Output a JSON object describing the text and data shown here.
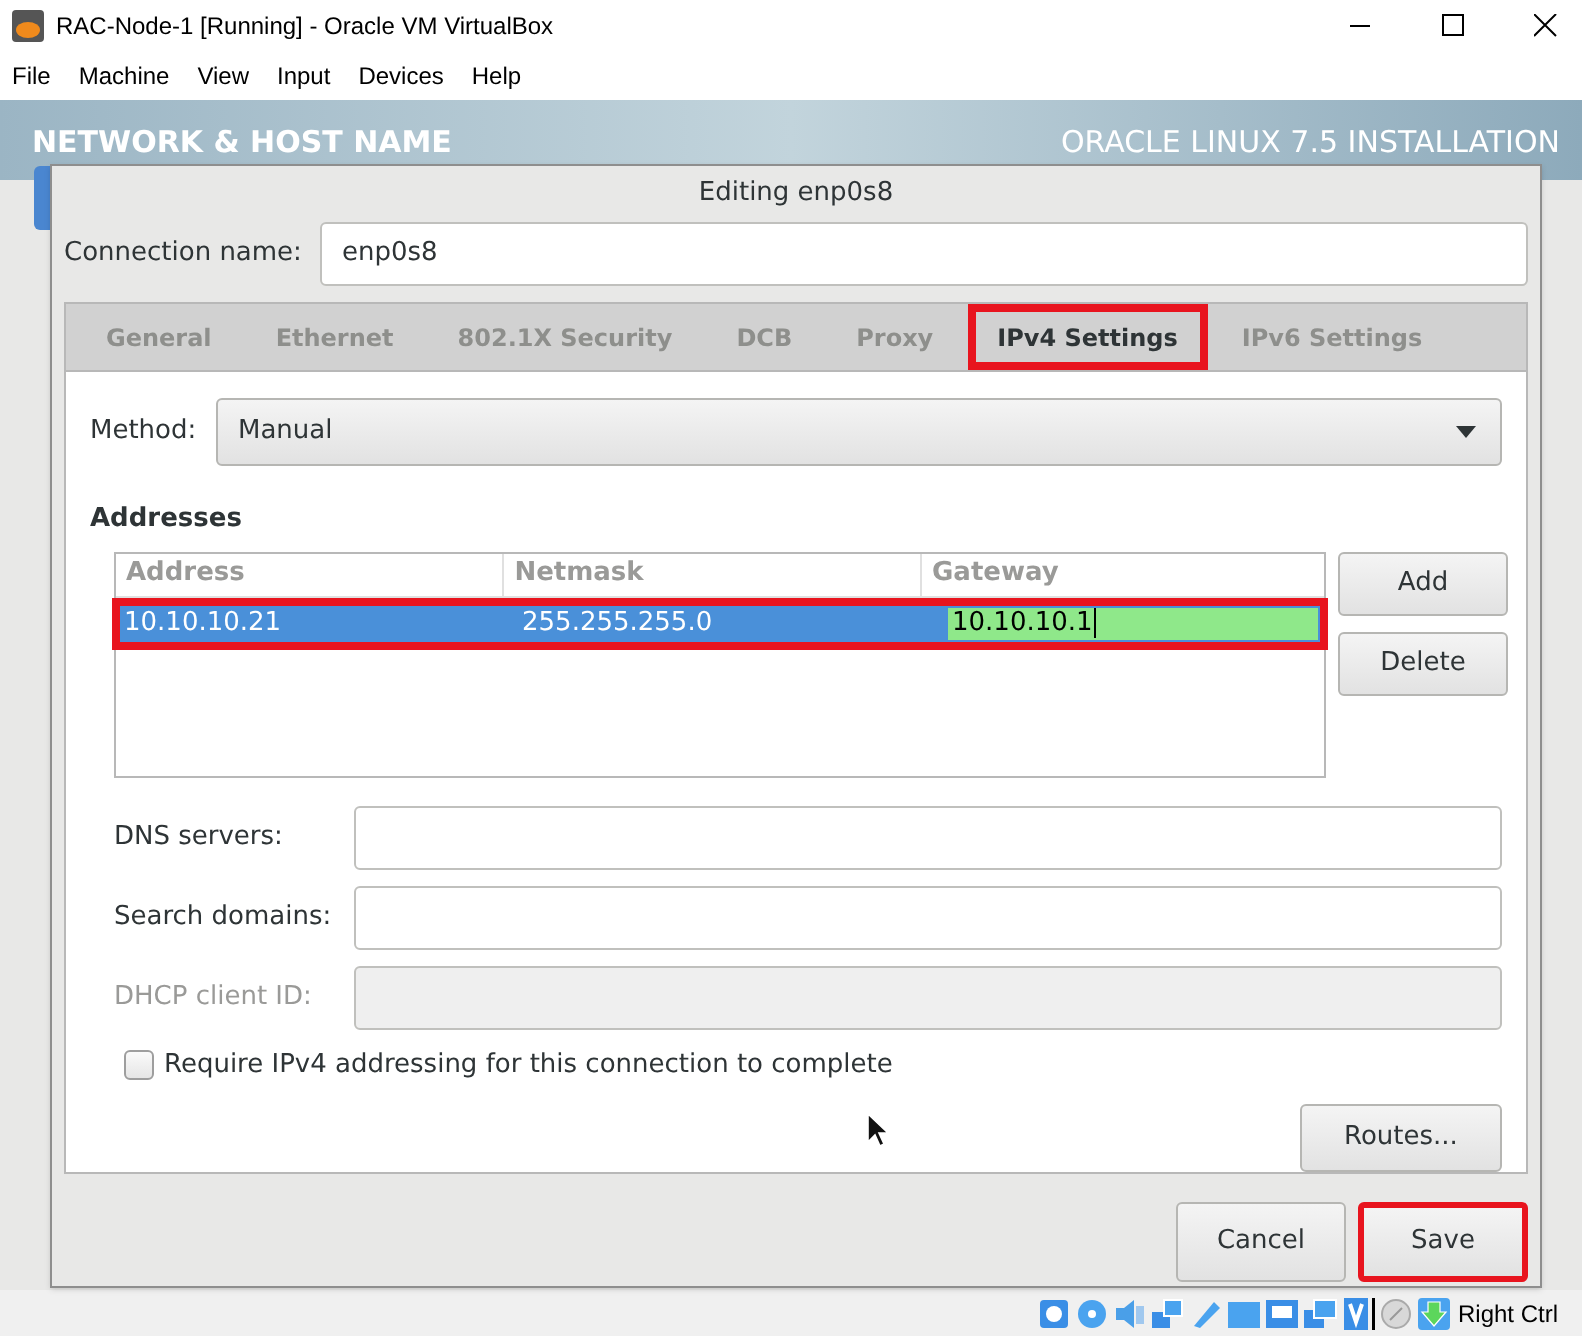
{
  "window": {
    "title": "RAC-Node-1 [Running] - Oracle VM VirtualBox"
  },
  "menu": [
    "File",
    "Machine",
    "View",
    "Input",
    "Devices",
    "Help"
  ],
  "installer": {
    "left_title": "NETWORK & HOST NAME",
    "right_title": "ORACLE LINUX 7.5 INSTALLATION"
  },
  "dialog": {
    "title": "Editing enp0s8",
    "connection_name": {
      "label": "Connection name:",
      "value": "enp0s8"
    },
    "tabs": [
      {
        "label": "General",
        "selected": false,
        "highlighted": false
      },
      {
        "label": "Ethernet",
        "selected": false,
        "highlighted": false
      },
      {
        "label": "802.1X Security",
        "selected": false,
        "highlighted": false
      },
      {
        "label": "DCB",
        "selected": false,
        "highlighted": false
      },
      {
        "label": "Proxy",
        "selected": false,
        "highlighted": false
      },
      {
        "label": "IPv4 Settings",
        "selected": true,
        "highlighted": true
      },
      {
        "label": "IPv6 Settings",
        "selected": false,
        "highlighted": false
      }
    ],
    "method": {
      "label": "Method:",
      "value": "Manual"
    },
    "addresses": {
      "title": "Addresses",
      "columns": [
        "Address",
        "Netmask",
        "Gateway"
      ],
      "rows": [
        {
          "selected": true,
          "highlighted": true,
          "cells": [
            {
              "text": "10.10.10.21",
              "editing": false
            },
            {
              "text": "255.255.255.0",
              "editing": false
            },
            {
              "text": "10.10.10.1",
              "editing": true
            }
          ]
        }
      ],
      "buttons": [
        "Add",
        "Delete"
      ]
    },
    "fields": [
      {
        "label": "DNS servers:",
        "disabled": false
      },
      {
        "label": "Search domains:",
        "disabled": false
      },
      {
        "label": "DHCP client ID:",
        "disabled": true
      }
    ],
    "require_checkbox": {
      "label": "Require IPv4 addressing for this connection to complete",
      "checked": false
    },
    "routes_button": "Routes...",
    "footer_buttons": [
      {
        "label": "Cancel",
        "highlighted": false
      },
      {
        "label": "Save",
        "highlighted": true
      }
    ]
  },
  "status_bar": {
    "host_key": "Right Ctrl"
  }
}
